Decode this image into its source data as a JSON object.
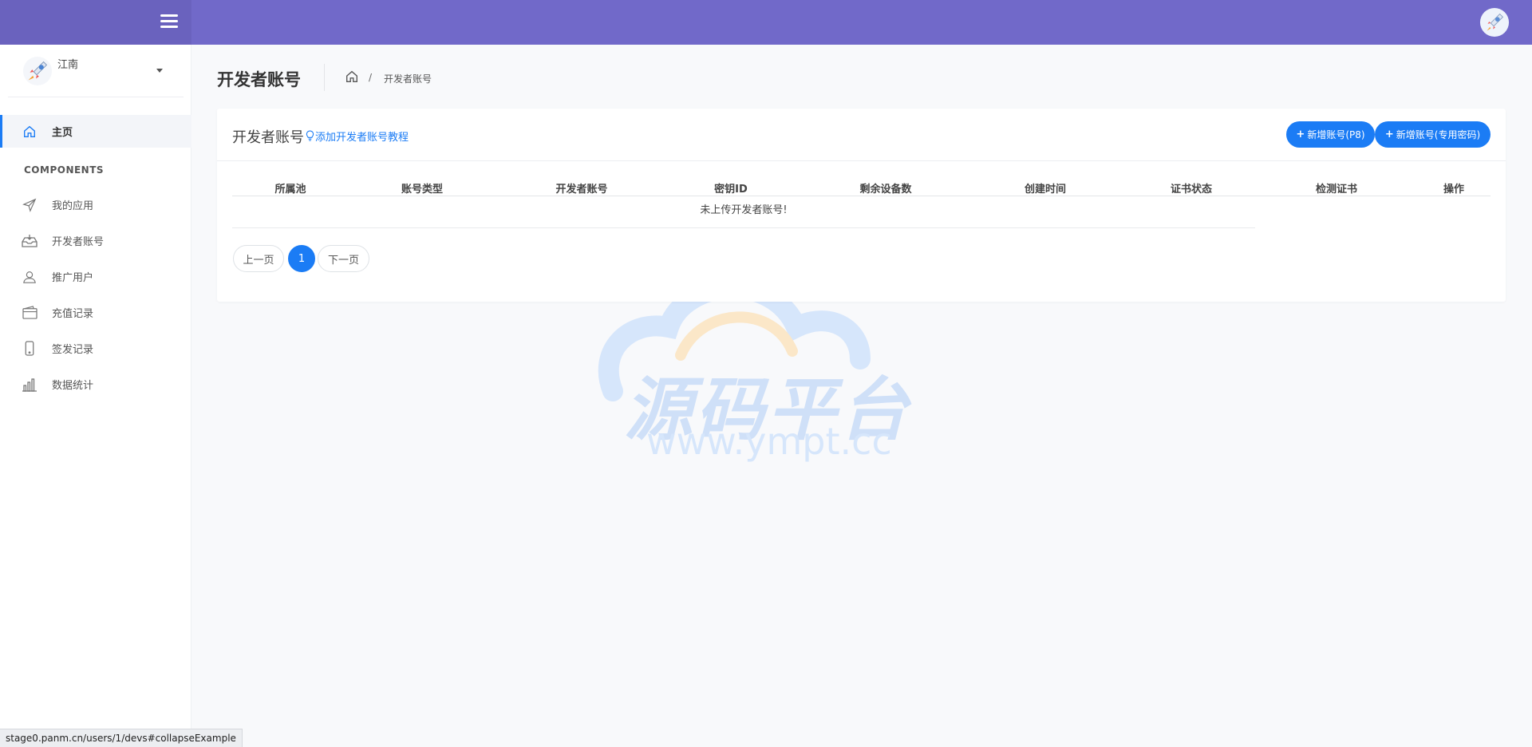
{
  "sidebar": {
    "user_name": "江南",
    "home_label": "主页",
    "section_title": "COMPONENTS",
    "items": [
      {
        "label": "我的应用",
        "icon": "send-icon"
      },
      {
        "label": "开发者账号",
        "icon": "inbox-icon"
      },
      {
        "label": "推广用户",
        "icon": "user-icon"
      },
      {
        "label": "充值记录",
        "icon": "wallet-icon"
      },
      {
        "label": "签发记录",
        "icon": "phone-icon"
      },
      {
        "label": "数据统计",
        "icon": "bar-chart-icon"
      }
    ]
  },
  "header": {
    "title": "开发者账号",
    "breadcrumb_sep": "/",
    "breadcrumb_current": "开发者账号"
  },
  "card": {
    "title": "开发者账号",
    "tutorial_link": "添加开发者账号教程",
    "btn_p8": "新增账号(P8)",
    "btn_pwd": "新增账号(专用密码)",
    "plus": "+"
  },
  "table": {
    "columns": [
      "所属池",
      "账号类型",
      "开发者账号",
      "密钥ID",
      "剩余设备数",
      "创建时间",
      "证书状态",
      "检测证书",
      "操作"
    ],
    "empty_text": "未上传开发者账号!"
  },
  "pagination": {
    "prev": "上一页",
    "current": "1",
    "next": "下一页"
  },
  "watermark": {
    "title": "源码平台",
    "url": "www.ympt.cc"
  },
  "status_url": "stage0.panm.cn/users/1/devs#collapseExample",
  "colors": {
    "topbar": "#7169c9",
    "accent": "#1b7cf5"
  }
}
